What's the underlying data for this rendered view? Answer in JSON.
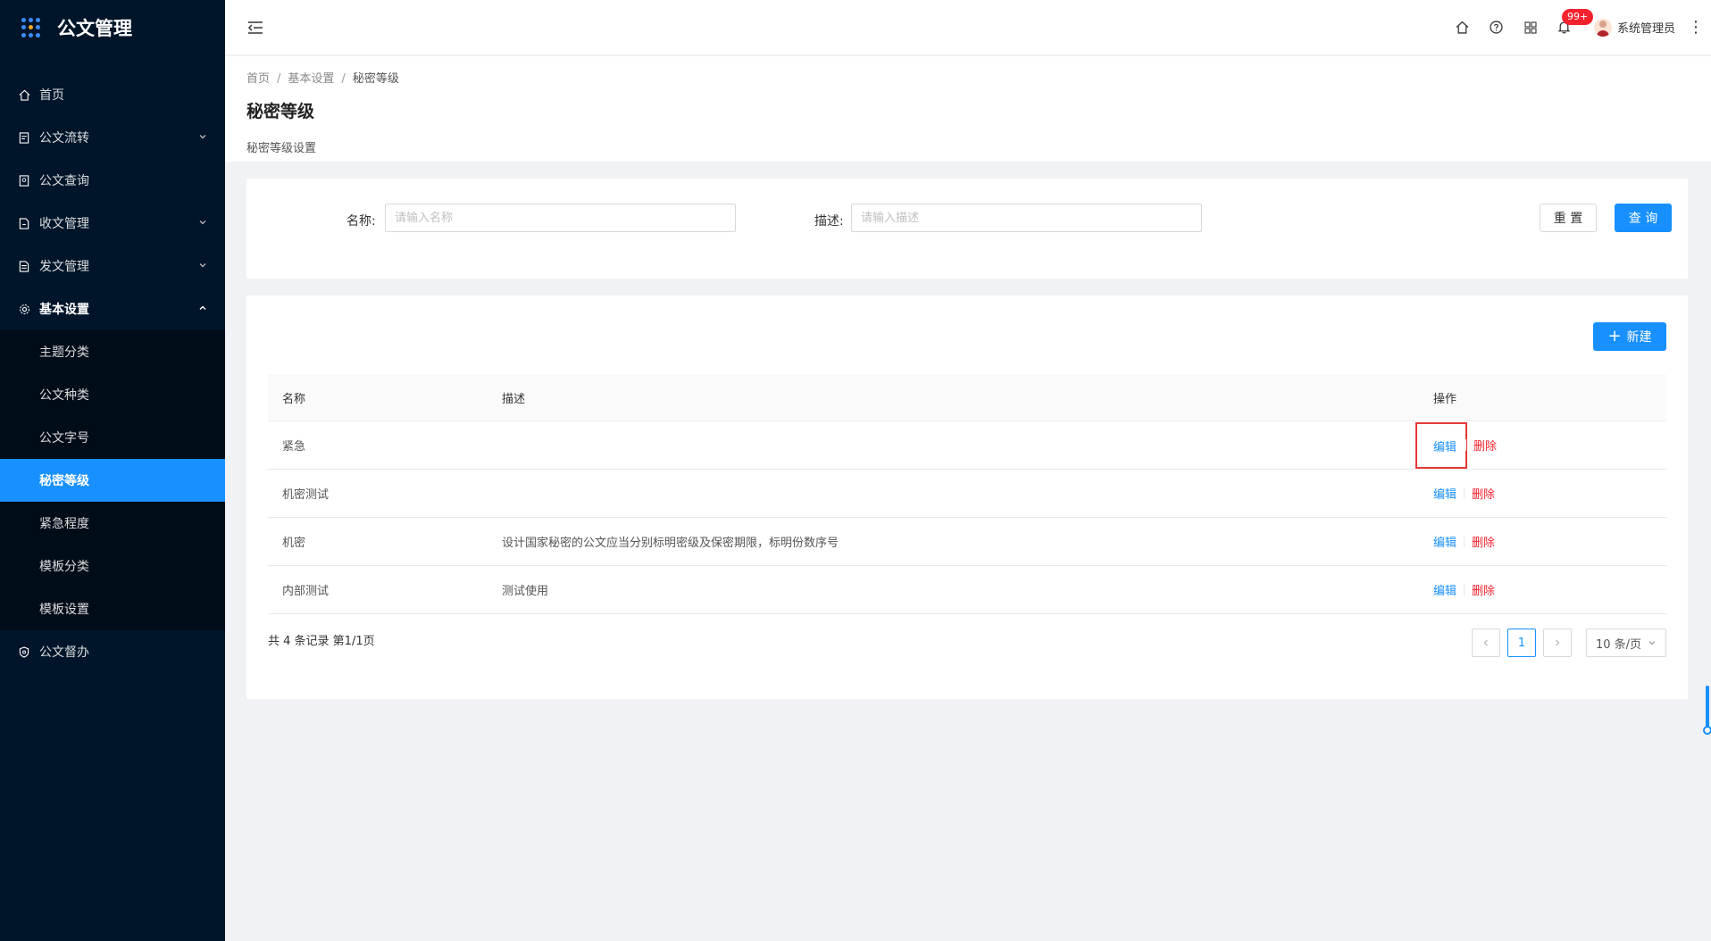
{
  "app": {
    "title": "公文管理"
  },
  "sidebar": {
    "menu": [
      {
        "label": "首页",
        "icon": "home-icon",
        "has_arrow": false
      },
      {
        "label": "公文流转",
        "icon": "document-flow-icon",
        "has_arrow": true
      },
      {
        "label": "公文查询",
        "icon": "document-search-icon",
        "has_arrow": false
      },
      {
        "label": "收文管理",
        "icon": "document-receive-icon",
        "has_arrow": true
      },
      {
        "label": "发文管理",
        "icon": "document-send-icon",
        "has_arrow": true
      },
      {
        "label": "基本设置",
        "icon": "gear-icon",
        "has_arrow": true,
        "open": true
      },
      {
        "label": "公文督办",
        "icon": "shield-icon",
        "has_arrow": false
      }
    ],
    "submenu": [
      {
        "label": "主题分类"
      },
      {
        "label": "公文种类"
      },
      {
        "label": "公文字号"
      },
      {
        "label": "秘密等级",
        "active": true
      },
      {
        "label": "紧急程度"
      },
      {
        "label": "模板分类"
      },
      {
        "label": "模板设置"
      }
    ]
  },
  "header": {
    "notification_badge": "99+",
    "username": "系统管理员"
  },
  "breadcrumb": [
    "首页",
    "基本设置",
    "秘密等级"
  ],
  "page": {
    "title": "秘密等级",
    "description": "秘密等级设置"
  },
  "search": {
    "name_label": "名称:",
    "name_placeholder": "请输入名称",
    "desc_label": "描述:",
    "desc_placeholder": "请输入描述",
    "reset_label": "重 置",
    "query_label": "查 询"
  },
  "table": {
    "new_label": "新建",
    "columns": [
      "名称",
      "描述",
      "操作"
    ],
    "rows": [
      {
        "name": "紧急",
        "desc": ""
      },
      {
        "name": "机密测试",
        "desc": ""
      },
      {
        "name": "机密",
        "desc": "设计国家秘密的公文应当分别标明密级及保密期限，标明份数序号"
      },
      {
        "name": "内部测试",
        "desc": "测试使用"
      }
    ],
    "edit_label": "编辑",
    "delete_label": "删除"
  },
  "pagination": {
    "summary": "共 4 条记录 第1/1页",
    "current_page": "1",
    "page_size": "10 条/页"
  },
  "colors": {
    "primary": "#1890ff",
    "sidebar_bg": "#001529",
    "danger": "#f5222d",
    "highlight": "#e53935"
  }
}
